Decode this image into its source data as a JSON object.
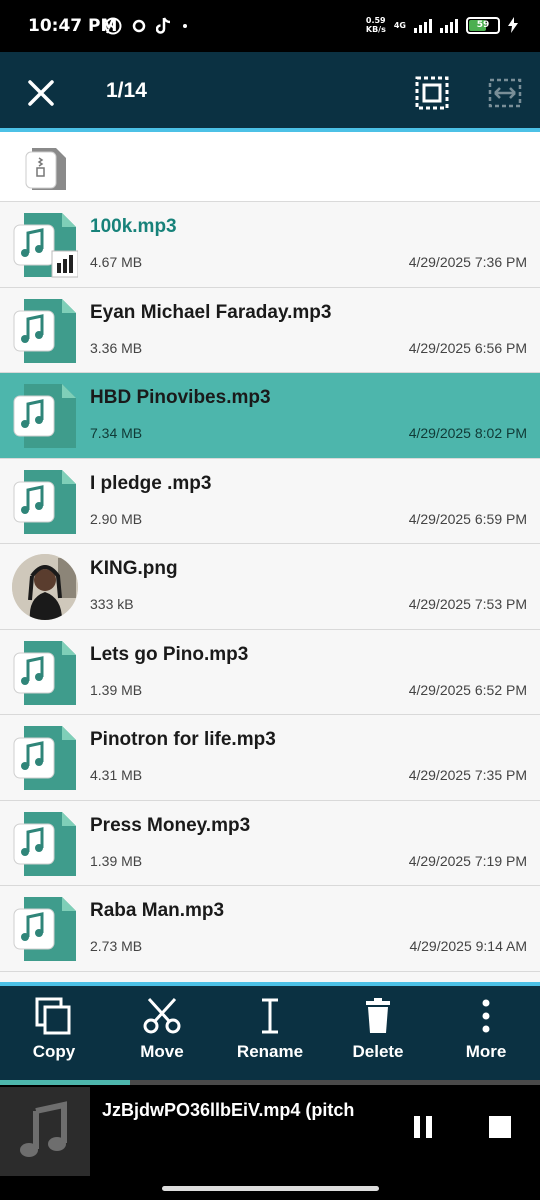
{
  "status_bar": {
    "time": "10:47 PM",
    "speed": "0.59",
    "speed_unit": "KB/s",
    "network": "4G",
    "battery": "59",
    "icons": [
      "whatsapp-icon",
      "circle-icon",
      "tiktok-icon",
      "dot-icon",
      "signal-icon",
      "wifi-icon",
      "charging-icon"
    ]
  },
  "app_bar": {
    "selection_count": "1/14",
    "close_icon": "close-icon",
    "select_all_icon": "select-all-icon",
    "select_range_icon": "select-range-icon"
  },
  "files": [
    {
      "name": "100k.mp3",
      "size": "4.67 MB",
      "date": "4/29/2025 7:36 PM",
      "type": "audio",
      "playing": true,
      "selected": false
    },
    {
      "name": "Eyan Michael Faraday.mp3",
      "size": "3.36 MB",
      "date": "4/29/2025 6:56 PM",
      "type": "audio",
      "playing": false,
      "selected": false
    },
    {
      "name": "HBD Pinovibes.mp3",
      "size": "7.34 MB",
      "date": "4/29/2025 8:02 PM",
      "type": "audio",
      "playing": false,
      "selected": true
    },
    {
      "name": "I pledge .mp3",
      "size": "2.90 MB",
      "date": "4/29/2025 6:59 PM",
      "type": "audio",
      "playing": false,
      "selected": false
    },
    {
      "name": "KING.png",
      "size": "333 kB",
      "date": "4/29/2025 7:53 PM",
      "type": "image",
      "playing": false,
      "selected": false
    },
    {
      "name": "Lets go Pino.mp3",
      "size": "1.39 MB",
      "date": "4/29/2025 6:52 PM",
      "type": "audio",
      "playing": false,
      "selected": false
    },
    {
      "name": "Pinotron for life.mp3",
      "size": "4.31 MB",
      "date": "4/29/2025 7:35 PM",
      "type": "audio",
      "playing": false,
      "selected": false
    },
    {
      "name": "Press Money.mp3",
      "size": "1.39 MB",
      "date": "4/29/2025 7:19 PM",
      "type": "audio",
      "playing": false,
      "selected": false
    },
    {
      "name": "Raba Man.mp3",
      "size": "2.73 MB",
      "date": "4/29/2025 9:14 AM",
      "type": "audio",
      "playing": false,
      "selected": false
    }
  ],
  "actions": [
    {
      "label": "Copy",
      "icon": "copy-icon"
    },
    {
      "label": "Move",
      "icon": "scissors-icon"
    },
    {
      "label": "Rename",
      "icon": "text-cursor-icon"
    },
    {
      "label": "Delete",
      "icon": "trash-icon"
    },
    {
      "label": "More",
      "icon": "more-vertical-icon"
    }
  ],
  "player": {
    "title": "JzBjdwPO36llbEiV.mp4 (pitch",
    "progress": 0.24,
    "art_icon": "music-note-icon",
    "pause_icon": "pause-icon",
    "stop_icon": "stop-icon"
  },
  "colors": {
    "header": "#0b3142",
    "accent_line": "#4cc1e6",
    "selected_row": "#4db6ac",
    "file_icon": "#3f9c8c",
    "playing_text": "#17827a"
  }
}
